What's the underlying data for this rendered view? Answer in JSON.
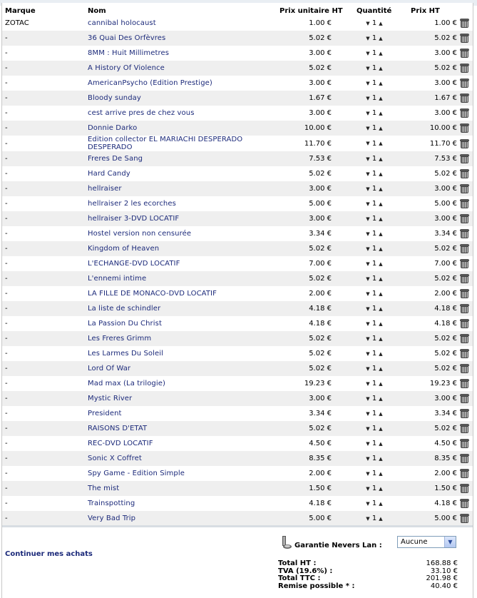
{
  "header": {
    "marque": "Marque",
    "nom": "Nom",
    "prix_unitaire": "Prix unitaire HT",
    "quantite": "Quantité",
    "prix_ht": "Prix HT"
  },
  "rows": [
    {
      "marque": "ZOTAC",
      "nom": "cannibal holocaust",
      "unit": "1.00 €",
      "qty": "1",
      "total": "1.00 €"
    },
    {
      "marque": "-",
      "nom": "36 Quai Des Orfèvres",
      "unit": "5.02 €",
      "qty": "1",
      "total": "5.02 €"
    },
    {
      "marque": "-",
      "nom": "8MM : Huit Millimetres",
      "unit": "3.00 €",
      "qty": "1",
      "total": "3.00 €"
    },
    {
      "marque": "-",
      "nom": "A History Of Violence",
      "unit": "5.02 €",
      "qty": "1",
      "total": "5.02 €"
    },
    {
      "marque": "-",
      "nom": "AmericanPsycho (Edition Prestige)",
      "unit": "3.00 €",
      "qty": "1",
      "total": "3.00 €"
    },
    {
      "marque": "-",
      "nom": "Bloody sunday",
      "unit": "1.67 €",
      "qty": "1",
      "total": "1.67 €"
    },
    {
      "marque": "-",
      "nom": "cest arrive pres de chez vous",
      "unit": "3.00 €",
      "qty": "1",
      "total": "3.00 €"
    },
    {
      "marque": "-",
      "nom": "Donnie Darko",
      "unit": "10.00 €",
      "qty": "1",
      "total": "10.00 €"
    },
    {
      "marque": "-",
      "nom": "Edition collector EL MARIACHI DESPERADO DESPERADO",
      "unit": "11.70 €",
      "qty": "1",
      "total": "11.70 €"
    },
    {
      "marque": "-",
      "nom": "Freres De Sang",
      "unit": "7.53 €",
      "qty": "1",
      "total": "7.53 €"
    },
    {
      "marque": "-",
      "nom": "Hard Candy",
      "unit": "5.02 €",
      "qty": "1",
      "total": "5.02 €"
    },
    {
      "marque": "-",
      "nom": "hellraiser",
      "unit": "3.00 €",
      "qty": "1",
      "total": "3.00 €"
    },
    {
      "marque": "-",
      "nom": "hellraiser 2 les ecorches",
      "unit": "5.00 €",
      "qty": "1",
      "total": "5.00 €"
    },
    {
      "marque": "-",
      "nom": "hellraiser 3-DVD LOCATIF",
      "unit": "3.00 €",
      "qty": "1",
      "total": "3.00 €"
    },
    {
      "marque": "-",
      "nom": "Hostel version non censurée",
      "unit": "3.34 €",
      "qty": "1",
      "total": "3.34 €"
    },
    {
      "marque": "-",
      "nom": "Kingdom of Heaven",
      "unit": "5.02 €",
      "qty": "1",
      "total": "5.02 €"
    },
    {
      "marque": "-",
      "nom": "L'ECHANGE-DVD LOCATIF",
      "unit": "7.00 €",
      "qty": "1",
      "total": "7.00 €"
    },
    {
      "marque": "-",
      "nom": "L'ennemi intime",
      "unit": "5.02 €",
      "qty": "1",
      "total": "5.02 €"
    },
    {
      "marque": "-",
      "nom": "LA FILLE DE MONACO-DVD LOCATIF",
      "unit": "2.00 €",
      "qty": "1",
      "total": "2.00 €"
    },
    {
      "marque": "-",
      "nom": "La liste de schindler",
      "unit": "4.18 €",
      "qty": "1",
      "total": "4.18 €"
    },
    {
      "marque": "-",
      "nom": "La Passion Du Christ",
      "unit": "4.18 €",
      "qty": "1",
      "total": "4.18 €"
    },
    {
      "marque": "-",
      "nom": "Les Freres Grimm",
      "unit": "5.02 €",
      "qty": "1",
      "total": "5.02 €"
    },
    {
      "marque": "-",
      "nom": "Les Larmes Du Soleil",
      "unit": "5.02 €",
      "qty": "1",
      "total": "5.02 €"
    },
    {
      "marque": "-",
      "nom": "Lord Of War",
      "unit": "5.02 €",
      "qty": "1",
      "total": "5.02 €"
    },
    {
      "marque": "-",
      "nom": "Mad max (La trilogie)",
      "unit": "19.23 €",
      "qty": "1",
      "total": "19.23 €"
    },
    {
      "marque": "-",
      "nom": "Mystic River",
      "unit": "3.00 €",
      "qty": "1",
      "total": "3.00 €"
    },
    {
      "marque": "-",
      "nom": "President",
      "unit": "3.34 €",
      "qty": "1",
      "total": "3.34 €"
    },
    {
      "marque": "-",
      "nom": "RAISONS D'ETAT",
      "unit": "5.02 €",
      "qty": "1",
      "total": "5.02 €"
    },
    {
      "marque": "-",
      "nom": "REC-DVD LOCATIF",
      "unit": "4.50 €",
      "qty": "1",
      "total": "4.50 €"
    },
    {
      "marque": "-",
      "nom": "Sonic X Coffret",
      "unit": "8.35 €",
      "qty": "1",
      "total": "8.35 €"
    },
    {
      "marque": "-",
      "nom": "Spy Game - Edition Simple",
      "unit": "2.00 €",
      "qty": "1",
      "total": "2.00 €"
    },
    {
      "marque": "-",
      "nom": "The mist",
      "unit": "1.50 €",
      "qty": "1",
      "total": "1.50 €"
    },
    {
      "marque": "-",
      "nom": "Trainspotting",
      "unit": "4.18 €",
      "qty": "1",
      "total": "4.18 €"
    },
    {
      "marque": "-",
      "nom": "Very Bad Trip",
      "unit": "5.00 €",
      "qty": "1",
      "total": "5.00 €"
    }
  ],
  "footer": {
    "continue_label": "Continuer mes achats",
    "warranty_label": "Garantie Nevers Lan :",
    "warranty_selected": "Aucune",
    "totals": [
      {
        "label": "Total HT :",
        "value": "168.88 €"
      },
      {
        "label": "TVA (19.6%) :",
        "value": "33.10 €"
      },
      {
        "label": "Total TTC :",
        "value": "201.98 €"
      },
      {
        "label": "Remise possible * :",
        "value": "40.40 €"
      }
    ]
  },
  "icons": {
    "qty_down": "▼",
    "qty_up": "▲",
    "delete": "trash-icon",
    "select_arrow": "▼"
  }
}
